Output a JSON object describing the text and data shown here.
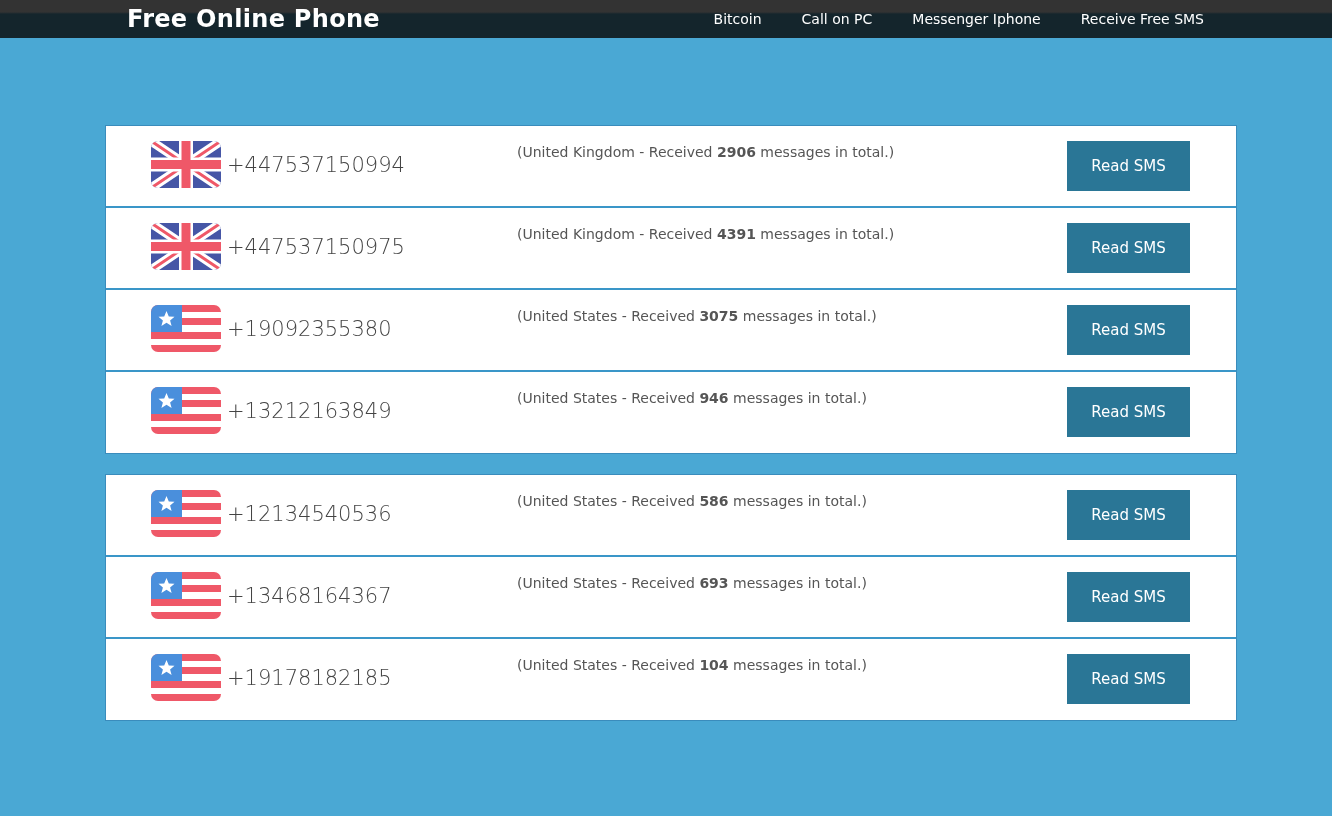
{
  "header": {
    "logo": "Free Online Phone",
    "nav": [
      "Bitcoin",
      "Call on PC",
      "Messenger Iphone",
      "Receive Free SMS"
    ]
  },
  "groups": [
    {
      "rows": [
        {
          "kind": "uk",
          "number": "+447537150994",
          "info": "(United Kingdom - Received **2906** messages in total.)",
          "button": "Read SMS"
        },
        {
          "kind": "uk",
          "number": "+447537150975",
          "info": "(United Kingdom - Received **4391** messages in total.)",
          "button": "Read SMS"
        },
        {
          "kind": "us",
          "number": "+19092355380",
          "info": "(United States - Received **3075** messages in total.)",
          "button": "Read SMS"
        },
        {
          "kind": "us",
          "number": "+13212163849",
          "info": "(United States - Received **946** messages in total.)",
          "button": "Read SMS"
        }
      ]
    },
    {
      "rows": [
        {
          "kind": "us",
          "number": "+12134540536",
          "info": "(United States - Received **586** messages in total.)",
          "button": "Read SMS"
        },
        {
          "kind": "us",
          "number": "+13468164367",
          "info": "(United States - Received **693** messages in total.)",
          "button": "Read SMS"
        },
        {
          "kind": "us",
          "number": "+19178182185",
          "info": "(United States - Received **104** messages in total.)",
          "button": "Read SMS"
        }
      ]
    }
  ]
}
